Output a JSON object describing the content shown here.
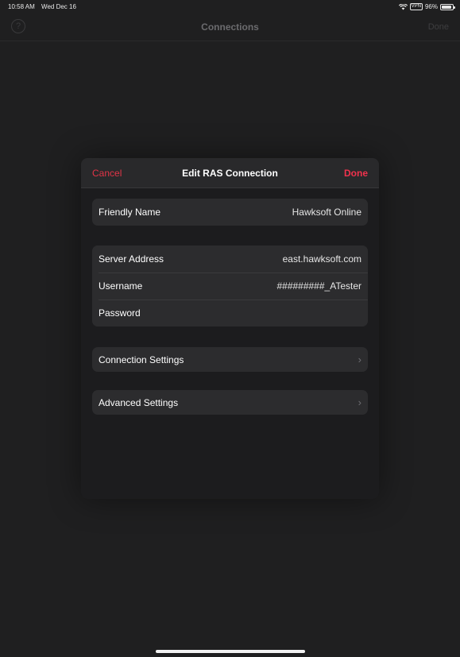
{
  "status_bar": {
    "time": "10:58 AM",
    "date": "Wed Dec 16",
    "vpn": "VPN",
    "battery": "96%",
    "battery_level": 0.96
  },
  "background_nav": {
    "help_symbol": "?",
    "title": "Connections",
    "done_label": "Done"
  },
  "sheet": {
    "cancel_label": "Cancel",
    "title": "Edit RAS Connection",
    "done_label": "Done",
    "friendly_name": {
      "label": "Friendly Name",
      "value": "Hawksoft Online"
    },
    "server_address": {
      "label": "Server Address",
      "value": "east.hawksoft.com"
    },
    "username": {
      "label": "Username",
      "value": "#########_ATester"
    },
    "password": {
      "label": "Password",
      "value": ""
    },
    "connection_settings": {
      "label": "Connection Settings",
      "chevron": "›"
    },
    "advanced_settings": {
      "label": "Advanced Settings",
      "chevron": "›"
    }
  },
  "colors": {
    "accent_red": "#f0324d",
    "background": "#1f1f20",
    "sheet_background": "#1c1c1e",
    "group_background": "#2c2c2e"
  }
}
